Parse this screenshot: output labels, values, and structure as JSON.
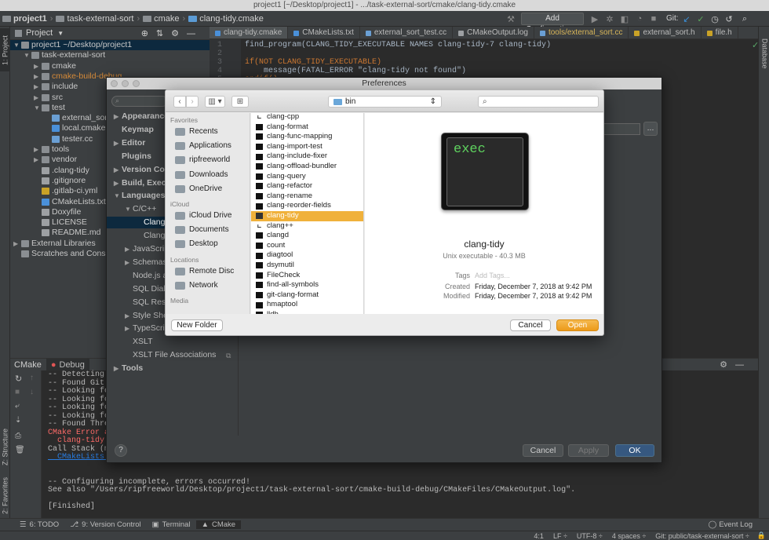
{
  "window": {
    "title": "project1 [~/Desktop/project1] - .../task-external-sort/cmake/clang-tidy.cmake"
  },
  "breadcrumb": [
    "project1",
    "task-external-sort",
    "cmake",
    "clang-tidy.cmake"
  ],
  "toolbar": {
    "config_label": "Add Configuration...",
    "git_label": "Git:"
  },
  "side_tabs": {
    "project": "1: Project",
    "structure": "Z: Structure",
    "favorites": "2: Favorites",
    "database": "Database"
  },
  "project_panel": {
    "title": "Project",
    "tree": [
      {
        "label": "project1  ~/Desktop/project1",
        "depth": 0,
        "arrow": "▼",
        "icon": "folder-icon",
        "selected": true
      },
      {
        "label": "task-external-sort",
        "depth": 1,
        "arrow": "▼",
        "icon": "folder-icon"
      },
      {
        "label": "cmake",
        "depth": 2,
        "arrow": "▶",
        "icon": "folder-icon"
      },
      {
        "label": "cmake-build-debug",
        "depth": 2,
        "arrow": "▶",
        "icon": "folder-icon",
        "color": "#d68a38"
      },
      {
        "label": "include",
        "depth": 2,
        "arrow": "▶",
        "icon": "folder-icon"
      },
      {
        "label": "src",
        "depth": 2,
        "arrow": "▶",
        "icon": "folder-icon"
      },
      {
        "label": "test",
        "depth": 2,
        "arrow": "▼",
        "icon": "folder-icon"
      },
      {
        "label": "external_sort",
        "depth": 3,
        "arrow": "",
        "icon": "cpp-file-icon"
      },
      {
        "label": "local.cmake",
        "depth": 3,
        "arrow": "",
        "icon": "cmake-file-icon"
      },
      {
        "label": "tester.cc",
        "depth": 3,
        "arrow": "",
        "icon": "cpp-file-icon"
      },
      {
        "label": "tools",
        "depth": 2,
        "arrow": "▶",
        "icon": "folder-icon"
      },
      {
        "label": "vendor",
        "depth": 2,
        "arrow": "▶",
        "icon": "folder-icon"
      },
      {
        "label": ".clang-tidy",
        "depth": 2,
        "arrow": "",
        "icon": "text-file-icon"
      },
      {
        "label": ".gitignore",
        "depth": 2,
        "arrow": "",
        "icon": "text-file-icon"
      },
      {
        "label": ".gitlab-ci.yml",
        "depth": 2,
        "arrow": "",
        "icon": "yaml-file-icon"
      },
      {
        "label": "CMakeLists.txt",
        "depth": 2,
        "arrow": "",
        "icon": "cmake-file-icon"
      },
      {
        "label": "Doxyfile",
        "depth": 2,
        "arrow": "",
        "icon": "text-file-icon"
      },
      {
        "label": "LICENSE",
        "depth": 2,
        "arrow": "",
        "icon": "text-file-icon"
      },
      {
        "label": "README.md",
        "depth": 2,
        "arrow": "",
        "icon": "md-file-icon"
      },
      {
        "label": "External Libraries",
        "depth": 0,
        "arrow": "▶",
        "icon": "library-icon"
      },
      {
        "label": "Scratches and Consoles",
        "depth": 0,
        "arrow": "",
        "icon": "scratch-icon"
      }
    ]
  },
  "editor": {
    "tabs": [
      "clang-tidy.cmake",
      "CMakeLists.txt",
      "external_sort_test.cc",
      "CMakeOutput.log",
      "tools/external_sort.cc",
      "external_sort.h",
      "file.h"
    ],
    "active_tab": 0,
    "lines": [
      {
        "n": "1",
        "text": "find_program(CLANG_TIDY_EXECUTABLE NAMES clang-tidy-7 clang-tidy)"
      },
      {
        "n": "2",
        "text": ""
      },
      {
        "n": "3",
        "text": "if(NOT CLANG_TIDY_EXECUTABLE)"
      },
      {
        "n": "4",
        "text": "    message(FATAL_ERROR \"clang-tidy not found\")"
      },
      {
        "n": "5",
        "text": "endif()"
      }
    ]
  },
  "bottom_panel": {
    "tabs": [
      "CMake",
      "Debug"
    ],
    "console": [
      {
        "text": "-- Detecting CX",
        "style": "normal"
      },
      {
        "text": "-- Found Git: /",
        "style": "normal"
      },
      {
        "text": "-- Looking for",
        "style": "normal"
      },
      {
        "text": "-- Looking for",
        "style": "normal"
      },
      {
        "text": "-- Looking for",
        "style": "normal"
      },
      {
        "text": "-- Looking for",
        "style": "normal"
      },
      {
        "text": "-- Found Thread",
        "style": "normal"
      },
      {
        "text": "CMake Error at",
        "style": "err"
      },
      {
        "text": "  clang-tidy no",
        "style": "err"
      },
      {
        "text": "Call Stack (mos",
        "style": "normal"
      },
      {
        "text": "  CMakeLists.tx",
        "style": "lk"
      },
      {
        "text": "",
        "style": "normal"
      },
      {
        "text": "",
        "style": "normal"
      },
      {
        "text": "-- Configuring incomplete, errors occurred!",
        "style": "normal"
      },
      {
        "text": "See also \"/Users/ripfreeworld/Desktop/project1/task-external-sort/cmake-build-debug/CMakeFiles/CMakeOutput.log\".",
        "style": "normal"
      },
      {
        "text": "",
        "style": "normal"
      },
      {
        "text": "[Finished]",
        "style": "normal"
      }
    ]
  },
  "tool_windows": [
    "6: TODO",
    "9: Version Control",
    "Terminal",
    "CMake"
  ],
  "event_log": "Event Log",
  "status_bar": [
    "4:1",
    "LF ÷",
    "UTF-8 ÷",
    "4 spaces ÷",
    "Git: public/task-external-sort ÷"
  ],
  "preferences": {
    "title": "Preferences",
    "nav": [
      {
        "label": "Appearance",
        "depth": 0,
        "arrow": "▶",
        "bold": true
      },
      {
        "label": "Keymap",
        "depth": 0,
        "arrow": "",
        "bold": true
      },
      {
        "label": "Editor",
        "depth": 0,
        "arrow": "▶",
        "bold": true
      },
      {
        "label": "Plugins",
        "depth": 0,
        "arrow": "",
        "bold": true
      },
      {
        "label": "Version Con",
        "depth": 0,
        "arrow": "▶",
        "bold": true
      },
      {
        "label": "Build, Execu",
        "depth": 0,
        "arrow": "▶",
        "bold": true
      },
      {
        "label": "Languages",
        "depth": 0,
        "arrow": "▼",
        "bold": true
      },
      {
        "label": "C/C++",
        "depth": 1,
        "arrow": "▼",
        "bold": false
      },
      {
        "label": "Clang-",
        "depth": 2,
        "arrow": "",
        "bold": false,
        "selected": true
      },
      {
        "label": "Clangd",
        "depth": 2,
        "arrow": "",
        "bold": false
      },
      {
        "label": "JavaScrip",
        "depth": 1,
        "arrow": "▶",
        "bold": false
      },
      {
        "label": "Schemas",
        "depth": 1,
        "arrow": "▶",
        "bold": false
      },
      {
        "label": "Node.js a",
        "depth": 1,
        "arrow": "",
        "bold": false
      },
      {
        "label": "SQL Diale",
        "depth": 1,
        "arrow": "",
        "bold": false
      },
      {
        "label": "SQL Reso",
        "depth": 1,
        "arrow": "",
        "bold": false
      },
      {
        "label": "Style She",
        "depth": 1,
        "arrow": "▶",
        "bold": false
      },
      {
        "label": "TypeScrip",
        "depth": 1,
        "arrow": "▶",
        "bold": false
      },
      {
        "label": "XSLT",
        "depth": 1,
        "arrow": "",
        "bold": false
      },
      {
        "label": "XSLT File Associations",
        "depth": 1,
        "arrow": "",
        "bold": false
      },
      {
        "label": "Tools",
        "depth": 0,
        "arrow": "▶",
        "bold": true
      }
    ],
    "buttons": {
      "cancel": "Cancel",
      "apply": "Apply",
      "ok": "OK",
      "help": "?",
      "browse": "..."
    }
  },
  "open_dialog": {
    "location": "bin",
    "sidebar": {
      "favorites_header": "Favorites",
      "favorites": [
        {
          "label": "Recents",
          "icon": "clock-icon"
        },
        {
          "label": "Applications",
          "icon": "applications-icon"
        },
        {
          "label": "ripfreeworld",
          "icon": "home-icon"
        },
        {
          "label": "Downloads",
          "icon": "downloads-icon"
        },
        {
          "label": "OneDrive",
          "icon": "folder-icon"
        }
      ],
      "icloud_header": "iCloud",
      "icloud": [
        {
          "label": "iCloud Drive",
          "icon": "cloud-icon"
        },
        {
          "label": "Documents",
          "icon": "documents-icon"
        },
        {
          "label": "Desktop",
          "icon": "desktop-icon"
        }
      ],
      "locations_header": "Locations",
      "locations": [
        {
          "label": "Remote Disc",
          "icon": "disc-icon"
        },
        {
          "label": "Network",
          "icon": "network-icon"
        }
      ],
      "media_header": "Media"
    },
    "files": [
      {
        "name": "clang-cpp",
        "kind": "alias"
      },
      {
        "name": "clang-format",
        "kind": "exec"
      },
      {
        "name": "clang-func-mapping",
        "kind": "exec"
      },
      {
        "name": "clang-import-test",
        "kind": "exec"
      },
      {
        "name": "clang-include-fixer",
        "kind": "exec"
      },
      {
        "name": "clang-offload-bundler",
        "kind": "exec"
      },
      {
        "name": "clang-query",
        "kind": "exec"
      },
      {
        "name": "clang-refactor",
        "kind": "exec"
      },
      {
        "name": "clang-rename",
        "kind": "exec"
      },
      {
        "name": "clang-reorder-fields",
        "kind": "exec"
      },
      {
        "name": "clang-tidy",
        "kind": "exec",
        "selected": true
      },
      {
        "name": "clang++",
        "kind": "alias"
      },
      {
        "name": "clangd",
        "kind": "exec"
      },
      {
        "name": "count",
        "kind": "exec"
      },
      {
        "name": "diagtool",
        "kind": "exec"
      },
      {
        "name": "dsymutil",
        "kind": "exec"
      },
      {
        "name": "FileCheck",
        "kind": "exec"
      },
      {
        "name": "find-all-symbols",
        "kind": "exec"
      },
      {
        "name": "git-clang-format",
        "kind": "exec"
      },
      {
        "name": "hmaptool",
        "kind": "exec"
      },
      {
        "name": "lldb",
        "kind": "exec"
      }
    ],
    "preview": {
      "icon_text": "exec",
      "name": "clang-tidy",
      "kind": "Unix executable - 40.3 MB",
      "tags_label": "Tags",
      "tags_placeholder": "Add Tags...",
      "created_label": "Created",
      "created": "Friday, December 7, 2018 at 9:42 PM",
      "modified_label": "Modified",
      "modified": "Friday, December 7, 2018 at 9:42 PM"
    },
    "buttons": {
      "new_folder": "New Folder",
      "cancel": "Cancel",
      "open": "Open"
    }
  }
}
